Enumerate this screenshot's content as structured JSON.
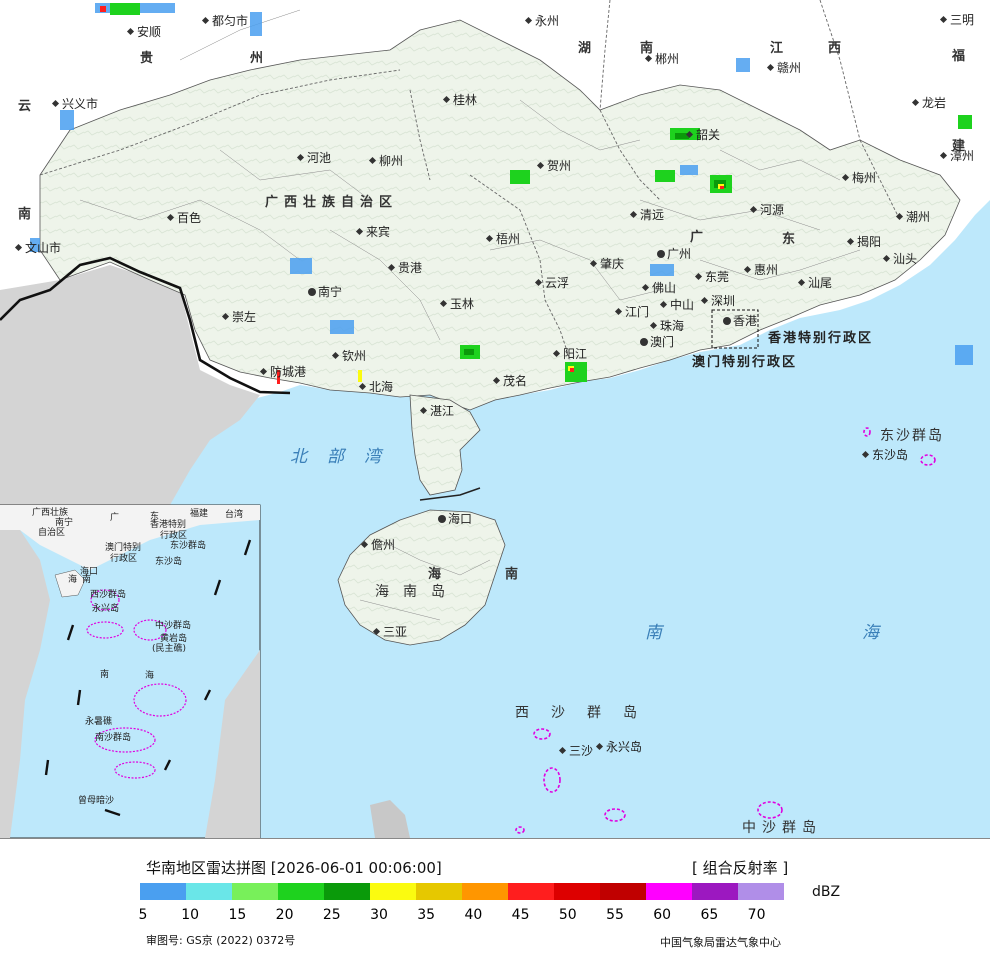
{
  "map": {
    "provinces": [
      "贵",
      "州",
      "湖",
      "南",
      "江",
      "西",
      "福",
      "建",
      "云",
      "南",
      "广西壮族自治区",
      "广",
      "东",
      "海",
      "南"
    ],
    "cities": [
      "安顺",
      "都匀市",
      "永州",
      "郴州",
      "赣州",
      "三明",
      "兴义市",
      "桂林",
      "龙岩",
      "韶关",
      "河池",
      "柳州",
      "贺州",
      "梅州",
      "漳州",
      "百色",
      "清远",
      "河源",
      "潮州",
      "来宾",
      "梧州",
      "广州",
      "揭阳",
      "文山市",
      "汕头",
      "贵港",
      "肇庆",
      "东莞",
      "惠州",
      "南宁",
      "云浮",
      "佛山",
      "汕尾",
      "崇左",
      "玉林",
      "江门",
      "中山",
      "深圳",
      "香港",
      "珠海",
      "澳门",
      "钦州",
      "防城港",
      "阳江",
      "北海",
      "茂名",
      "湛江",
      "海口",
      "儋州",
      "三亚",
      "东沙岛",
      "三沙",
      "永兴岛"
    ],
    "sar_labels": [
      "香港特别行政区",
      "澳门特别行政区"
    ],
    "sea_labels": [
      "北部湾",
      "南海",
      "东沙群岛",
      "西沙群岛",
      "中沙群岛"
    ],
    "island_label": "海南岛",
    "inset_labels": [
      "广西壮族",
      "自治区",
      "南宁",
      "广",
      "东",
      "福建",
      "台湾",
      "香港特别",
      "行政区",
      "澳门特别",
      "行政区",
      "东沙群岛",
      "东沙岛",
      "海口",
      "海",
      "南",
      "西沙群岛",
      "永兴岛",
      "中沙群岛",
      "黄岩岛",
      "(民主礁)",
      "南",
      "海",
      "永暑礁",
      "南沙群岛",
      "曾母暗沙"
    ]
  },
  "footer": {
    "title": "华南地区雷达拼图 [2026-06-01 00:06:00]",
    "product": "[ 组合反射率 ]",
    "unit": "dBZ",
    "ticks": [
      "5",
      "10",
      "15",
      "20",
      "25",
      "30",
      "35",
      "40",
      "45",
      "50",
      "55",
      "60",
      "65",
      "70"
    ],
    "colors": [
      "#4a9ff0",
      "#6ae6e8",
      "#78f05a",
      "#1ed21e",
      "#0a9a0a",
      "#fbfb10",
      "#e6c800",
      "#ff9600",
      "#ff1e1e",
      "#dd0000",
      "#c00000",
      "#ff00ff",
      "#9c18c0",
      "#b08ee8"
    ],
    "review_no": "审图号: GS京 (2022) 0372号",
    "credit": "中国气象局雷达气象中心"
  }
}
